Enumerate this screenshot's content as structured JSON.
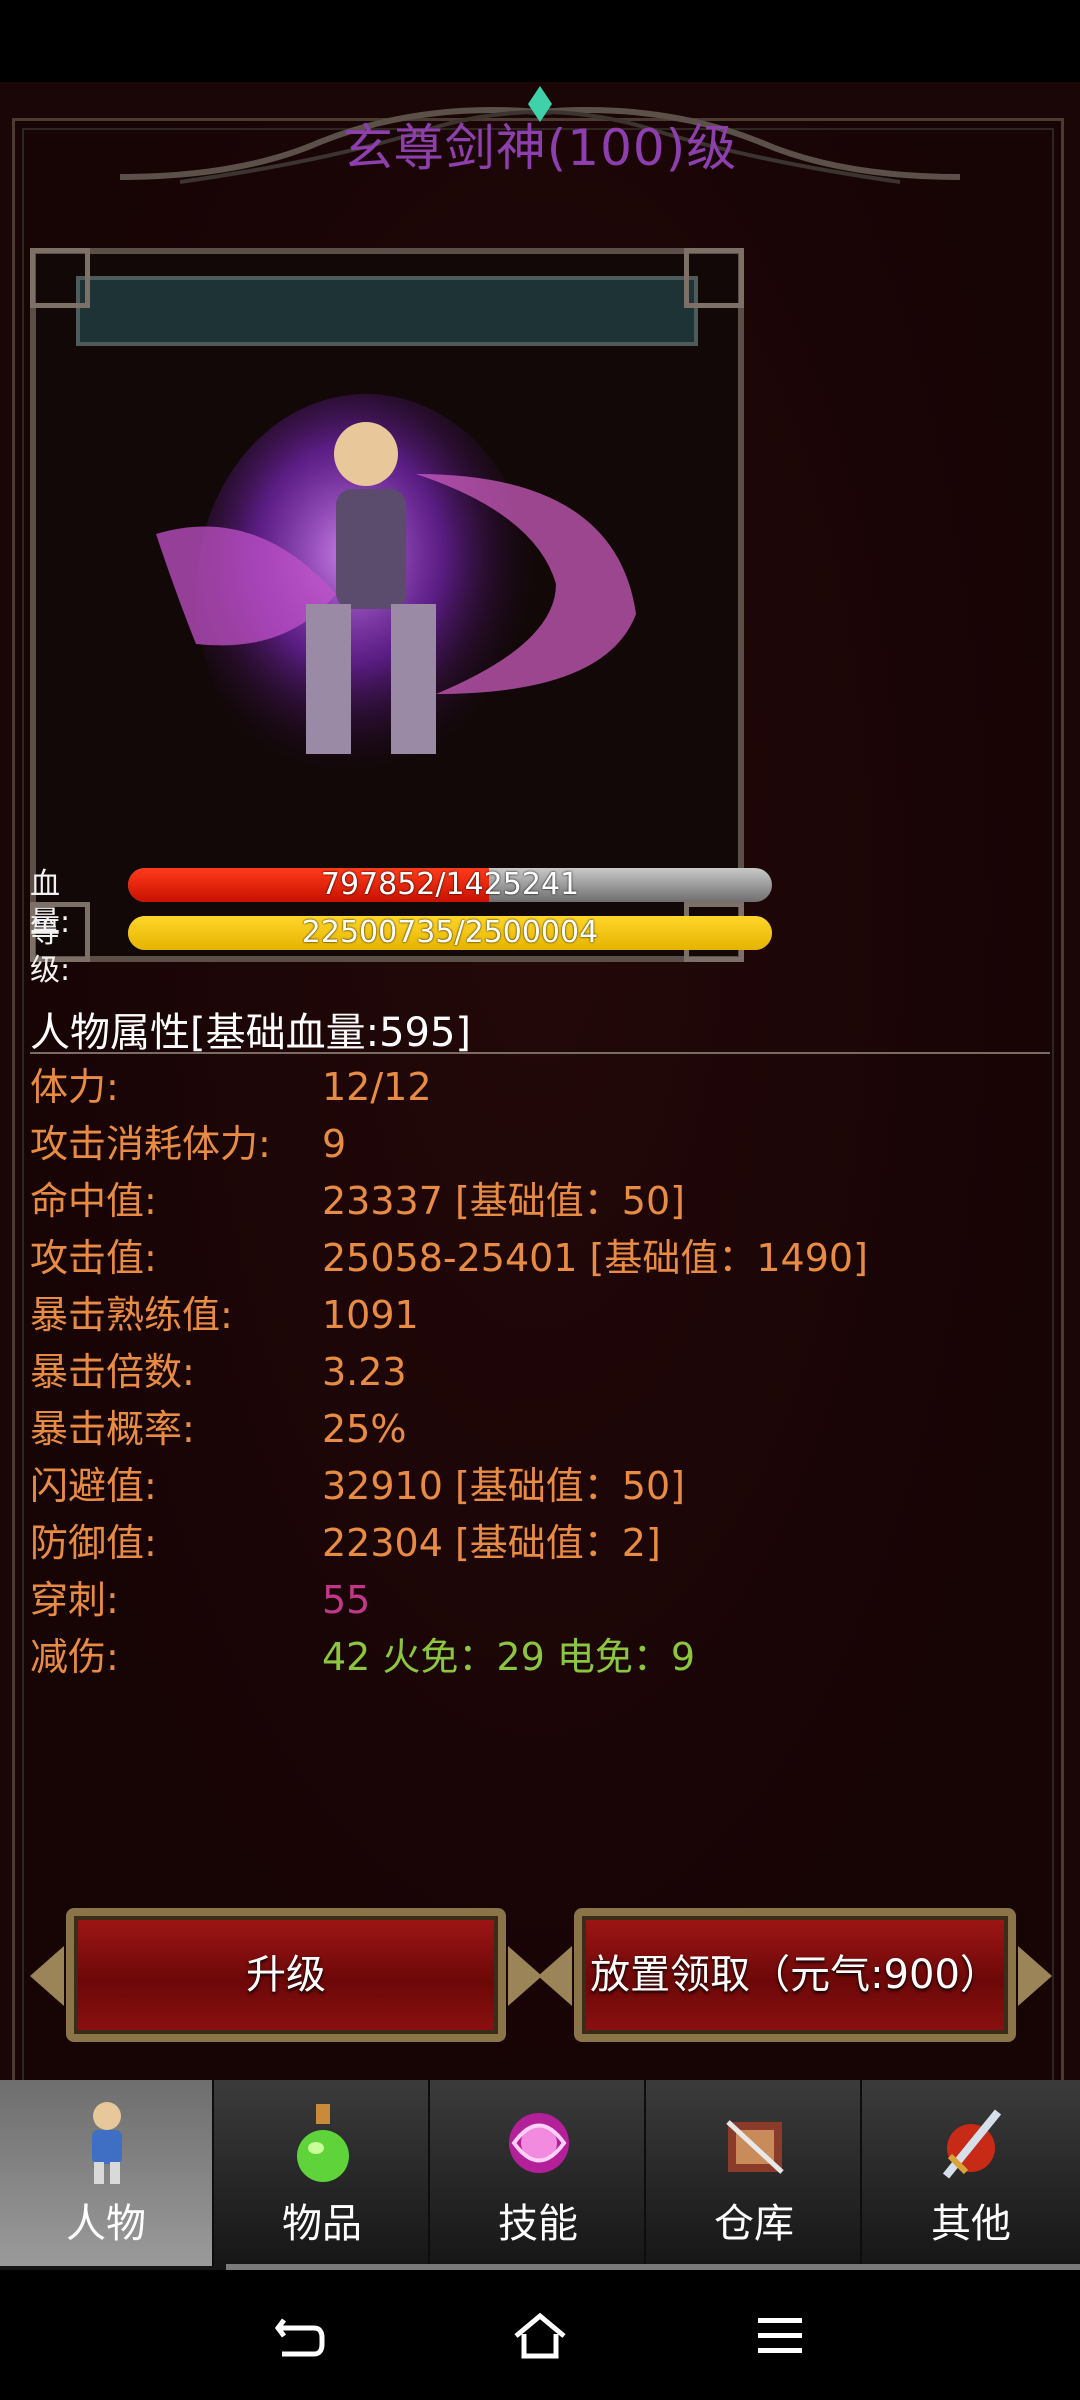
{
  "title": "玄尊剑神(100)级",
  "bars": {
    "hp": {
      "label": "血量:",
      "text": "797852/1425241",
      "fill": 0.56
    },
    "level": {
      "label": "等级:",
      "text": "22500735/2500004",
      "fill": 1.0
    }
  },
  "attributes": {
    "header": "人物属性[基础血量:595]",
    "rows": [
      {
        "label": "体力:",
        "value": "12/12",
        "color": "#e98c43"
      },
      {
        "label": "攻击消耗体力:",
        "value": "9",
        "color": "#e98c43"
      },
      {
        "label": "命中值:",
        "value": "23337 [基础值：50]",
        "color": "#e98c43"
      },
      {
        "label": "攻击值:",
        "value": "25058-25401 [基础值：1490]",
        "color": "#e98c43"
      },
      {
        "label": "暴击熟练值:",
        "value": "1091",
        "color": "#e98c43"
      },
      {
        "label": "暴击倍数:",
        "value": "3.23",
        "color": "#e98c43"
      },
      {
        "label": "暴击概率:",
        "value": "25%",
        "color": "#e98c43"
      },
      {
        "label": "闪避值:",
        "value": "32910 [基础值：50]",
        "color": "#e98c43"
      },
      {
        "label": "防御值:",
        "value": "22304 [基础值：2]",
        "color": "#e98c43"
      },
      {
        "label": "穿刺:",
        "value": "55",
        "color": "#c2378a"
      },
      {
        "label": "减伤:",
        "value": "42 火免：29 电免：9",
        "color": "#8cc63f"
      }
    ]
  },
  "actions": {
    "upgrade": "升级",
    "collect": "放置领取（元气:900）"
  },
  "tabs": [
    {
      "label": "人物",
      "icon": "character-icon",
      "active": true
    },
    {
      "label": "物品",
      "icon": "potion-icon",
      "active": false
    },
    {
      "label": "技能",
      "icon": "skill-orb-icon",
      "active": false
    },
    {
      "label": "仓库",
      "icon": "warehouse-icon",
      "active": false
    },
    {
      "label": "其他",
      "icon": "sword-icon",
      "active": false
    }
  ],
  "system_nav": {
    "back": "back-icon",
    "home": "home-icon",
    "menu": "menu-icon"
  }
}
